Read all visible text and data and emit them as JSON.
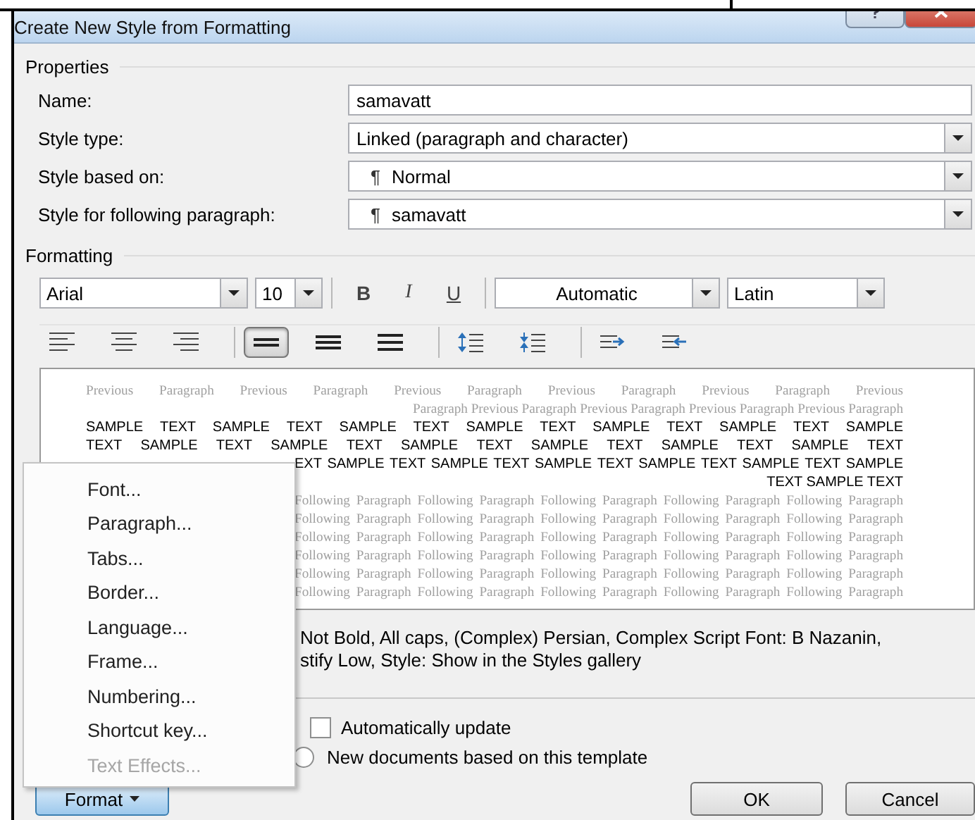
{
  "window": {
    "title": "Create New Style from Formatting"
  },
  "properties": {
    "heading": "Properties",
    "fields": [
      {
        "label": "Name:",
        "kind": "text",
        "value": "samavatt"
      },
      {
        "label": "Style type:",
        "kind": "dropdown",
        "value": "Linked (paragraph and character)"
      },
      {
        "label": "Style based on:",
        "kind": "style-dropdown",
        "mark": "¶",
        "value": "Normal"
      },
      {
        "label": "Style for following paragraph:",
        "kind": "style-dropdown",
        "mark": "¶",
        "value": "samavatt"
      }
    ]
  },
  "formatting": {
    "heading": "Formatting",
    "font": "Arial",
    "size": "10",
    "styles": [
      {
        "kind": "bold",
        "label": "B",
        "on": false
      },
      {
        "kind": "italic",
        "label": "I",
        "on": false
      },
      {
        "kind": "underline",
        "label": "U",
        "on": false
      }
    ],
    "font_color": "Automatic",
    "script": "Latin",
    "alignment": [
      {
        "kind": "left",
        "selected": false
      },
      {
        "kind": "center",
        "selected": false
      },
      {
        "kind": "right",
        "selected": false
      }
    ],
    "line_spacing": [
      {
        "kind": "single",
        "selected": true
      },
      {
        "kind": "one-half",
        "selected": false
      },
      {
        "kind": "double",
        "selected": false
      }
    ],
    "paragraph_spacing": [
      {
        "kind": "increase"
      },
      {
        "kind": "decrease"
      }
    ],
    "indent": [
      {
        "kind": "increase"
      },
      {
        "kind": "decrease"
      }
    ]
  },
  "preview": {
    "paragraphs": [
      {
        "kind": "previous",
        "lines": [
          {
            "text": "Previous Paragraph Previous Paragraph Previous Paragraph Previous Paragraph Previous Paragraph Previous",
            "covered": false
          },
          {
            "text": "Paragraph Previous Paragraph Previous Paragraph Previous Paragraph Previous Paragraph",
            "covered": false
          }
        ]
      },
      {
        "kind": "sample",
        "lines": [
          {
            "text": "SAMPLE TEXT SAMPLE TEXT SAMPLE TEXT SAMPLE TEXT SAMPLE TEXT SAMPLE TEXT SAMPLE",
            "covered": false
          },
          {
            "text": "TEXT SAMPLE TEXT SAMPLE TEXT SAMPLE TEXT SAMPLE TEXT SAMPLE TEXT SAMPLE TEXT",
            "covered": false
          },
          {
            "text": "EXT SAMPLE TEXT SAMPLE TEXT SAMPLE TEXT SAMPLE TEXT SAMPLE TEXT SAMPLE",
            "covered": true
          },
          {
            "text": "TEXT SAMPLE TEXT",
            "covered": false
          }
        ]
      },
      {
        "kind": "following",
        "lines": [
          {
            "text": "Following Paragraph Following Paragraph Following Paragraph Following Paragraph Following Paragraph",
            "covered": true
          },
          {
            "text": "Following Paragraph Following Paragraph Following Paragraph Following Paragraph Following Paragraph",
            "covered": true
          },
          {
            "text": "Following Paragraph Following Paragraph Following Paragraph Following Paragraph Following Paragraph",
            "covered": true
          },
          {
            "text": "Following Paragraph Following Paragraph Following Paragraph Following Paragraph Following Paragraph",
            "covered": true
          },
          {
            "text": "Following Paragraph Following Paragraph Following Paragraph Following Paragraph Following Paragraph",
            "covered": true
          },
          {
            "text": "Following Paragraph Following Paragraph Following Paragraph Following Paragraph Following Paragraph",
            "covered": true
          }
        ]
      }
    ]
  },
  "description": [
    "Not Bold, All caps, (Complex) Persian, Complex Script Font: B Nazanin,",
    "stify Low, Style: Show in the Styles gallery"
  ],
  "options": {
    "auto_update": {
      "label": "Automatically update",
      "checked": false
    },
    "template": {
      "label": "New documents based on this template",
      "selected": false
    }
  },
  "format_menu": {
    "open": true,
    "items": [
      {
        "label": "Font...",
        "disabled": false
      },
      {
        "label": "Paragraph...",
        "disabled": false
      },
      {
        "label": "Tabs...",
        "disabled": false
      },
      {
        "label": "Border...",
        "disabled": false
      },
      {
        "label": "Language...",
        "disabled": false
      },
      {
        "label": "Frame...",
        "disabled": false
      },
      {
        "label": "Numbering...",
        "disabled": false
      },
      {
        "label": "Shortcut key...",
        "disabled": false
      },
      {
        "label": "Text Effects...",
        "disabled": true
      }
    ]
  },
  "buttons": {
    "format": "Format",
    "ok": "OK",
    "cancel": "Cancel"
  }
}
